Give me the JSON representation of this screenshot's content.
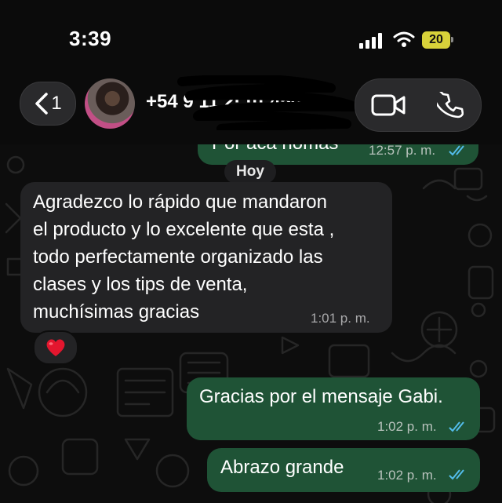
{
  "status_bar": {
    "time": "3:39",
    "battery": "20"
  },
  "header": {
    "back_count": "1",
    "contact_name": "+54 9 11 2· ··· 4505",
    "back_icon": "chevron-left-icon",
    "video_icon": "video-camera-icon",
    "phone_icon": "phone-icon"
  },
  "messages": {
    "previous": {
      "text": "Por aca nomas",
      "time": "12:57 p. m."
    },
    "date_divider": "Hoy",
    "incoming": {
      "lines": [
        "Agradezco  lo rápido que mandaron",
        "el producto y lo excelente que esta ,",
        "todo perfectamente organizado las",
        "clases y los tips de venta,",
        "muchísimas gracias"
      ],
      "time": "1:01 p. m.",
      "reaction": "❤️"
    },
    "outgoing_1": {
      "text": "Gracias por el mensaje Gabi.",
      "time": "1:02 p. m."
    },
    "outgoing_2": {
      "text": "Abrazo grande",
      "time": "1:02 p. m."
    }
  },
  "colors": {
    "outgoing_bubble": "#1f5336",
    "incoming_bubble": "#232325",
    "read_ticks": "#53bdeb",
    "battery": "#d8d23a"
  }
}
